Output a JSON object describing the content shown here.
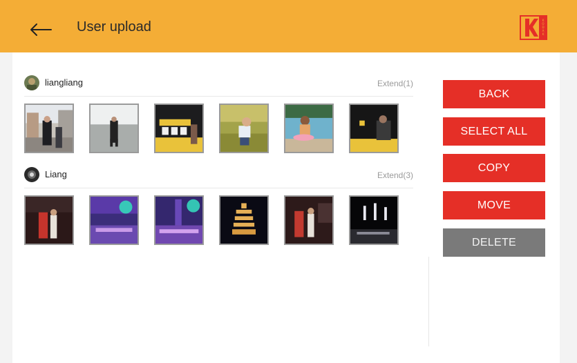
{
  "header": {
    "title": "User upload",
    "logo_letter": "K",
    "logo_text": "KODAK"
  },
  "sections": [
    {
      "username": "liangliang",
      "extend_label": "Extend(1)",
      "photo_count": 6
    },
    {
      "username": "Liang",
      "extend_label": "Extend(3)",
      "photo_count": 6
    }
  ],
  "actions": {
    "back_label": "BACK",
    "select_all_label": "SELECT ALL",
    "copy_label": "COPY",
    "move_label": "MOVE",
    "delete_label": "DELETE"
  },
  "colors": {
    "header_bg": "#f4ad36",
    "accent_red": "#e52f27",
    "disabled_gray": "#7a7a7a"
  }
}
